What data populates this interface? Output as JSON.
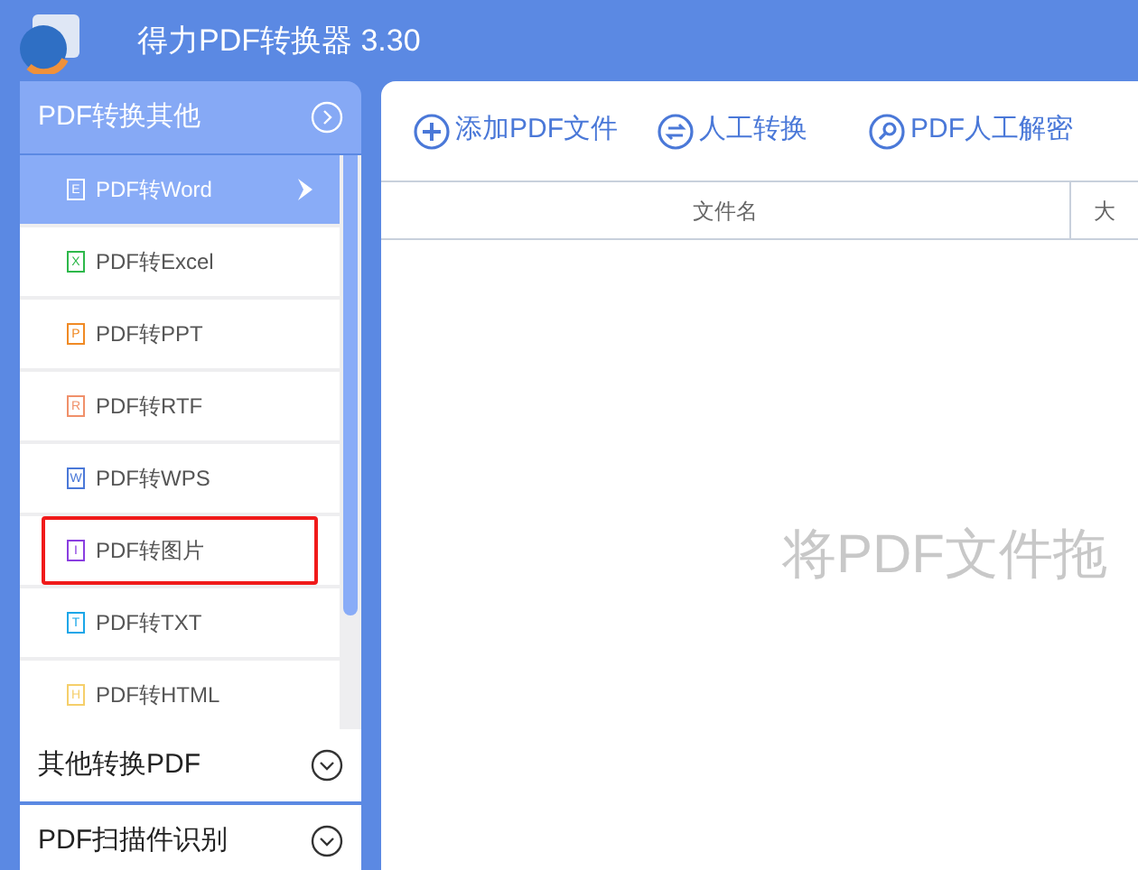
{
  "window": {
    "title": "得力PDF转换器 3.30"
  },
  "sidebar": {
    "groups": [
      {
        "label": "PDF转换其他",
        "expanded": true,
        "items": [
          {
            "label": "PDF转Word",
            "letter": "E",
            "color": "#ffffff",
            "selected": true,
            "highlighted": false
          },
          {
            "label": "PDF转Excel",
            "letter": "X",
            "color": "#2db84a",
            "selected": false,
            "highlighted": false
          },
          {
            "label": "PDF转PPT",
            "letter": "P",
            "color": "#f08a24",
            "selected": false,
            "highlighted": false
          },
          {
            "label": "PDF转RTF",
            "letter": "R",
            "color": "#f0906a",
            "selected": false,
            "highlighted": false
          },
          {
            "label": "PDF转WPS",
            "letter": "W",
            "color": "#4a78d8",
            "selected": false,
            "highlighted": false
          },
          {
            "label": "PDF转图片",
            "letter": "I",
            "color": "#8a3ee0",
            "selected": false,
            "highlighted": true
          },
          {
            "label": "PDF转TXT",
            "letter": "T",
            "color": "#1aa6e8",
            "selected": false,
            "highlighted": false
          },
          {
            "label": "PDF转HTML",
            "letter": "H",
            "color": "#f5cf6a",
            "selected": false,
            "highlighted": false
          }
        ]
      },
      {
        "label": "其他转换PDF",
        "expanded": false
      },
      {
        "label": "PDF扫描件识别",
        "expanded": false
      }
    ]
  },
  "toolbar": [
    {
      "label": "添加PDF文件",
      "kind": "add"
    },
    {
      "label": "人工转换",
      "kind": "swap"
    },
    {
      "label": "PDF人工解密",
      "kind": "key"
    }
  ],
  "table": {
    "columns": [
      "文件名",
      "大"
    ],
    "placeholder": "将PDF文件拖"
  }
}
